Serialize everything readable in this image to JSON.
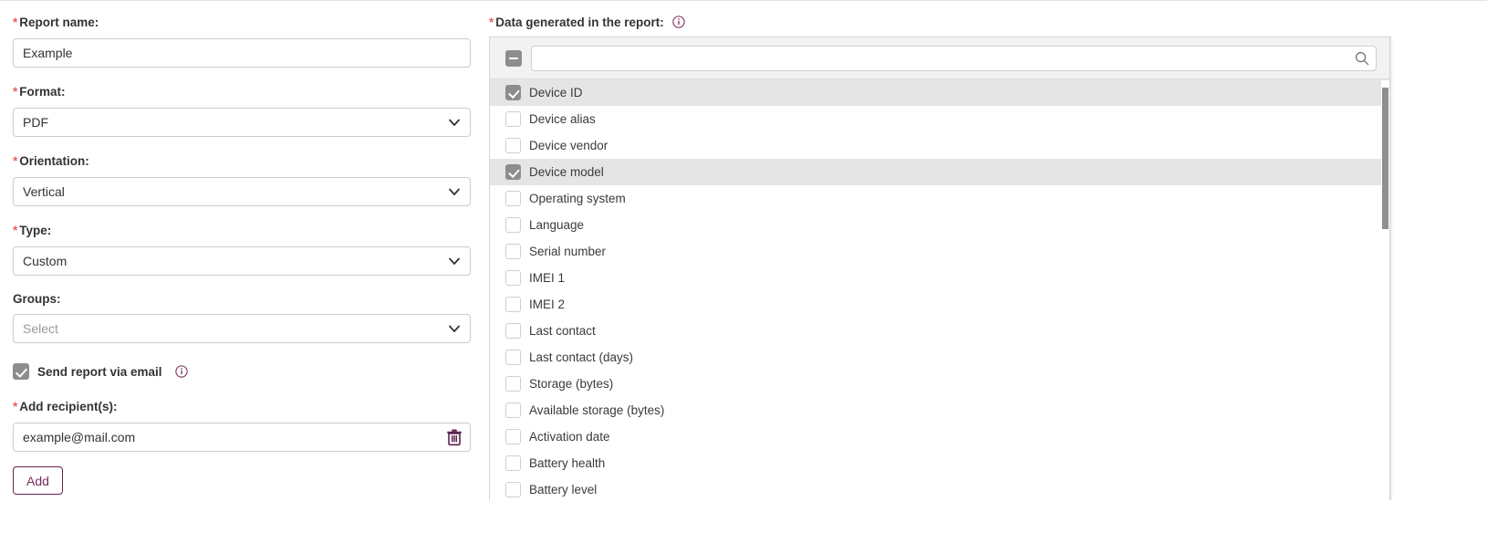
{
  "form": {
    "report_name": {
      "label": "Report name:",
      "required": true,
      "value": "Example"
    },
    "format": {
      "label": "Format:",
      "required": true,
      "value": "PDF"
    },
    "orientation": {
      "label": "Orientation:",
      "required": true,
      "value": "Vertical"
    },
    "type": {
      "label": "Type:",
      "required": true,
      "value": "Custom"
    },
    "groups": {
      "label": "Groups:",
      "required": false,
      "value": "",
      "placeholder": "Select"
    },
    "send_email": {
      "label": "Send report via email",
      "checked": true,
      "info_icon": "info-circle-icon"
    },
    "recipients": {
      "label": "Add recipient(s):",
      "required": true,
      "value": "example@mail.com",
      "delete_icon": "trash-icon"
    },
    "add_button": {
      "label": "Add"
    }
  },
  "data_panel": {
    "label": "Data generated in the report:",
    "required": true,
    "info_icon": "info-circle-icon",
    "select_all": {
      "state": "indeterminate",
      "name": "select-all-checkbox"
    },
    "search": {
      "value": "",
      "placeholder": "",
      "icon": "search-icon"
    },
    "options": [
      {
        "label": "Device ID",
        "checked": true
      },
      {
        "label": "Device alias",
        "checked": false
      },
      {
        "label": "Device vendor",
        "checked": false
      },
      {
        "label": "Device model",
        "checked": true
      },
      {
        "label": "Operating system",
        "checked": false
      },
      {
        "label": "Language",
        "checked": false
      },
      {
        "label": "Serial number",
        "checked": false
      },
      {
        "label": "IMEI 1",
        "checked": false
      },
      {
        "label": "IMEI 2",
        "checked": false
      },
      {
        "label": "Last contact",
        "checked": false
      },
      {
        "label": "Last contact (days)",
        "checked": false
      },
      {
        "label": "Storage (bytes)",
        "checked": false
      },
      {
        "label": "Available storage (bytes)",
        "checked": false
      },
      {
        "label": "Activation date",
        "checked": false
      },
      {
        "label": "Battery health",
        "checked": false
      },
      {
        "label": "Battery level",
        "checked": false
      }
    ]
  },
  "colors": {
    "accent": "#7a2a5c",
    "required_star": "#e06666",
    "checkbox_fill": "#8d8d8d",
    "row_alt": "#e5e5e5",
    "panel_header": "#f2f2f2",
    "border": "#cccccc"
  }
}
